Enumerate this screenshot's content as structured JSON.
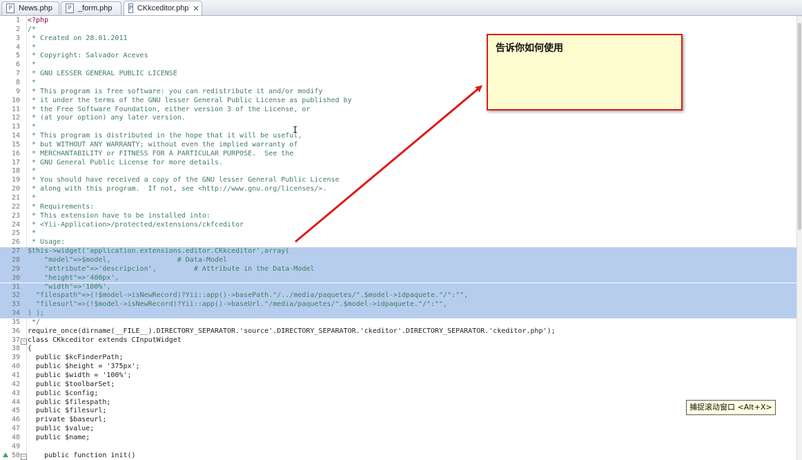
{
  "tabs": [
    {
      "label": "News.php",
      "active": false,
      "icon": "php-file-icon"
    },
    {
      "label": "_form.php",
      "active": false,
      "icon": "php-file-icon"
    },
    {
      "label": "CKkceditor.php",
      "active": true,
      "icon": "php-file-icon",
      "close": "✕"
    }
  ],
  "annotation": {
    "text": "告诉你如何使用",
    "border_color": "#dd1a1a",
    "fill_color": "#fefdd0"
  },
  "tooltip": {
    "text": "捕捉滚动窗口 <Alt+X>"
  },
  "colors": {
    "selection": "#b6cdee",
    "comment": "#3f7f5f",
    "keyword": "#7f0055",
    "string": "#2a00ff",
    "variable": "#0000c0"
  },
  "lines": [
    {
      "n": "1",
      "text": "<?php",
      "cls": "c-kw"
    },
    {
      "n": "2",
      "text": "/*",
      "cls": "c-comment"
    },
    {
      "n": "3",
      "text": " * Created on 28.01.2011",
      "cls": "c-comment"
    },
    {
      "n": "4",
      "text": " *",
      "cls": "c-comment"
    },
    {
      "n": "5",
      "text": " * Copyright: Salvador Aceves",
      "cls": "c-comment"
    },
    {
      "n": "6",
      "text": " *",
      "cls": "c-comment"
    },
    {
      "n": "7",
      "text": " * GNU LESSER GENERAL PUBLIC LICENSE",
      "cls": "c-comment"
    },
    {
      "n": "8",
      "text": " *",
      "cls": "c-comment"
    },
    {
      "n": "9",
      "text": " * This program is free software: you can redistribute it and/or modify",
      "cls": "c-comment"
    },
    {
      "n": "10",
      "text": " * it under the terms of the GNU lesser General Public License as published by",
      "cls": "c-comment"
    },
    {
      "n": "11",
      "text": " * the Free Software Foundation, either version 3 of the License, or",
      "cls": "c-comment"
    },
    {
      "n": "12",
      "text": " * (at your option) any later version.",
      "cls": "c-comment"
    },
    {
      "n": "13",
      "text": " *",
      "cls": "c-comment"
    },
    {
      "n": "14",
      "text": " * This program is distributed in the hope that it will be useful,",
      "cls": "c-comment"
    },
    {
      "n": "15",
      "text": " * but WITHOUT ANY WARRANTY; without even the implied warranty of",
      "cls": "c-comment"
    },
    {
      "n": "16",
      "text": " * MERCHANTABILITY or FITNESS FOR A PARTICULAR PURPOSE.  See the",
      "cls": "c-comment"
    },
    {
      "n": "17",
      "text": " * GNU General Public License for more details.",
      "cls": "c-comment"
    },
    {
      "n": "18",
      "text": " *",
      "cls": "c-comment"
    },
    {
      "n": "19",
      "text": " * You should have received a copy of the GNU lesser General Public License",
      "cls": "c-comment"
    },
    {
      "n": "20",
      "text": " * along with this program.  If not, see <http://www.gnu.org/licenses/>.",
      "cls": "c-comment"
    },
    {
      "n": "21",
      "text": " *",
      "cls": "c-comment"
    },
    {
      "n": "22",
      "text": " * Requirements:",
      "cls": "c-comment"
    },
    {
      "n": "23",
      "text": " * This extension have to be installed into:",
      "cls": "c-comment"
    },
    {
      "n": "24",
      "text": " * <Yii-Application>/protected/extensions/ckfceditor",
      "cls": "c-comment"
    },
    {
      "n": "25",
      "text": " *",
      "cls": "c-comment"
    },
    {
      "n": "26",
      "text": " * Usage:",
      "cls": "c-comment"
    },
    {
      "n": "27",
      "text": "$this->widget('application.extensions.editor.CKkceditor',array(",
      "cls": "c-comment",
      "sel": true
    },
    {
      "n": "28",
      "text": "    \"model\"=>$model,                # Data-Model",
      "cls": "c-comment",
      "sel": true
    },
    {
      "n": "29",
      "text": "    \"attribute\"=>'descripcion',         # Attribute in the Data-Model",
      "cls": "c-comment",
      "sel": true
    },
    {
      "n": "30",
      "text": "    \"height\"=>'400px',",
      "cls": "c-comment",
      "sel": true
    },
    {
      "n": "31",
      "text": "    \"width\"=>'100%',",
      "cls": "c-comment",
      "sel": true
    },
    {
      "n": "32",
      "text": "  \"filespath\"=>(!$model->isNewRecord)?Yii::app()->basePath.\"/../media/paquetes/\".$model->idpaquete.\"/\":\"\",",
      "cls": "c-comment",
      "sel": true
    },
    {
      "n": "33",
      "text": "  \"filesurl\"=>(!$model->isNewRecord)?Yii::app()->baseUrl.\"/media/paquetes/\".$model->idpaquete.\"/\":\"\",",
      "cls": "c-comment",
      "sel": true
    },
    {
      "n": "34",
      "text": ") );",
      "cls": "c-comment",
      "sel": true
    },
    {
      "n": "35",
      "text": " */",
      "cls": "c-comment"
    },
    {
      "n": "36",
      "text": "require_once(dirname(__FILE__).DIRECTORY_SEPARATOR.'source'.DIRECTORY_SEPARATOR.'ckeditor'.DIRECTORY_SEPARATOR.'ckeditor.php');",
      "cls": ""
    },
    {
      "n": "37",
      "text": "class CKkceditor extends CInputWidget",
      "cls": "",
      "fold": "−"
    },
    {
      "n": "38",
      "text": "{",
      "cls": ""
    },
    {
      "n": "39",
      "text": "  public $kcFinderPath;",
      "cls": ""
    },
    {
      "n": "40",
      "text": "  public $height = '375px';",
      "cls": ""
    },
    {
      "n": "41",
      "text": "  public $width = '100%';",
      "cls": ""
    },
    {
      "n": "42",
      "text": "  public $toolbarSet;",
      "cls": ""
    },
    {
      "n": "43",
      "text": "  public $config;",
      "cls": ""
    },
    {
      "n": "44",
      "text": "  public $filespath;",
      "cls": ""
    },
    {
      "n": "45",
      "text": "  public $filesurl;",
      "cls": ""
    },
    {
      "n": "46",
      "text": "  private $baseurl;",
      "cls": ""
    },
    {
      "n": "47",
      "text": "  public $value;",
      "cls": ""
    },
    {
      "n": "48",
      "text": "  public $name;",
      "cls": ""
    },
    {
      "n": "49",
      "text": "",
      "cls": ""
    },
    {
      "n": "50",
      "text": "    public function init()",
      "cls": "",
      "fold": "−"
    }
  ]
}
